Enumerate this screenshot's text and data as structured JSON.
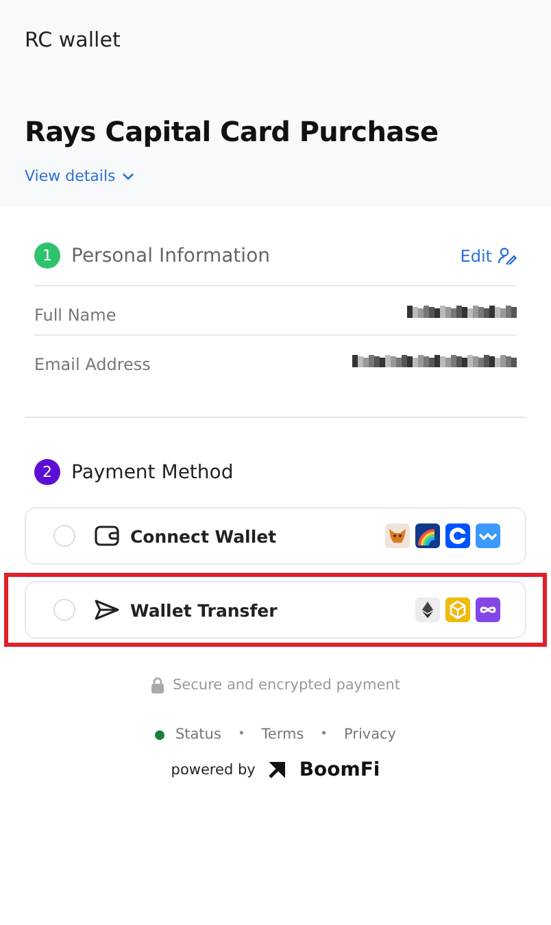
{
  "header": {
    "brand": "RC wallet",
    "title": "Rays Capital Card Purchase",
    "details_link": "View details"
  },
  "personal": {
    "step": "1",
    "title": "Personal Information",
    "edit": "Edit",
    "fields": [
      {
        "label": "Full Name",
        "redacted": true
      },
      {
        "label": "Email Address",
        "redacted": true
      }
    ]
  },
  "payment": {
    "step": "2",
    "title": "Payment Method",
    "methods": [
      {
        "kind": "wallet",
        "label": "Connect Wallet",
        "selected": false,
        "highlighted": false,
        "logos": [
          {
            "kind": "fox"
          },
          {
            "kind": "rainbow"
          },
          {
            "kind": "coin"
          },
          {
            "kind": "wave"
          }
        ]
      },
      {
        "kind": "transfer",
        "label": "Wallet Transfer",
        "selected": false,
        "highlighted": true,
        "logos": [
          {
            "kind": "diamond"
          },
          {
            "kind": "cube"
          },
          {
            "kind": "infinity"
          }
        ]
      }
    ]
  },
  "secure_note": "Secure and encrypted payment",
  "footer": {
    "links": [
      {
        "label": "Status",
        "color": "#16803c"
      },
      {
        "label": "Terms"
      },
      {
        "label": "Privacy"
      }
    ],
    "separator": "•",
    "powered_by": "powered by",
    "brand": "BoomFi"
  }
}
